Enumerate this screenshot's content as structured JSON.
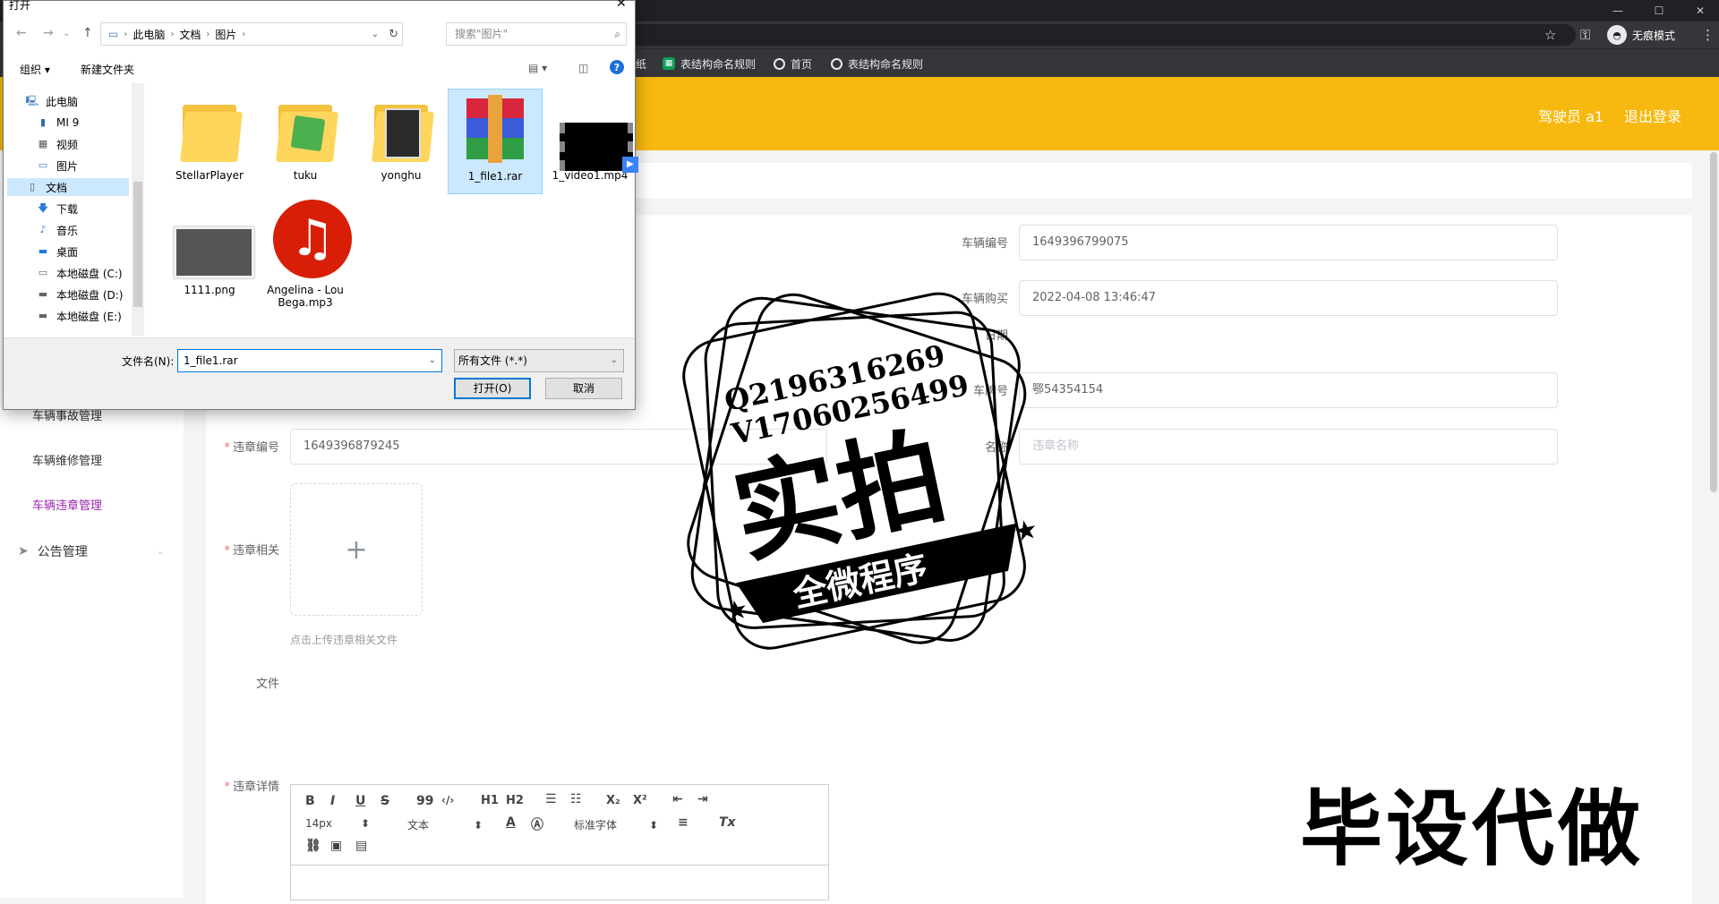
{
  "browser": {
    "incognito_label": "无痕模式",
    "bookmarks": [
      {
        "label": "纸",
        "icon": "none"
      },
      {
        "label": "表结构命名规则",
        "icon": "sheet-icon"
      },
      {
        "label": "首页",
        "icon": "globe-icon"
      },
      {
        "label": "表结构命名规则",
        "icon": "globe-icon"
      }
    ]
  },
  "header": {
    "user_label": "驾驶员 a1",
    "logout_label": "退出登录",
    "bg_color": "#f7b90f"
  },
  "sidebar": {
    "items": [
      {
        "label": "车辆事故管理",
        "active": false
      },
      {
        "label": "车辆维修管理",
        "active": false
      },
      {
        "label": "车辆违章管理",
        "active": true
      }
    ],
    "group": {
      "label": "公告管理"
    }
  },
  "form": {
    "vehicle_no": {
      "label": "车辆编号",
      "value": "1649396799075"
    },
    "purchase_date": {
      "label": "车辆购买",
      "label2": "日期",
      "value": "2022-04-08 13:46:47"
    },
    "plate_no": {
      "label": "车牌号",
      "value": "鄂54354154"
    },
    "violation_no": {
      "label": "违章编号",
      "value": "1649396879245"
    },
    "violation_name": {
      "label": "名称",
      "placeholder": "违章名称"
    },
    "related": {
      "label": "违章相关",
      "plus": "+",
      "hint": "点击上传违章相关文件"
    },
    "file_label": "文件",
    "details": {
      "label": "违章详情"
    }
  },
  "editor": {
    "bold": "B",
    "italic": "I",
    "underline": "U",
    "strike": "S",
    "quote": "99",
    "code": "‹/›",
    "h1": "H1",
    "h2": "H2",
    "sub": "X₂",
    "sup": "X²",
    "font_size": "14px",
    "text_style": "文本",
    "font_family": "标准字体"
  },
  "dialog": {
    "title": "打开",
    "breadcrumb": [
      "此电脑",
      "文档",
      "图片"
    ],
    "search_placeholder": "搜索\"图片\"",
    "organize_label": "组织 ▾",
    "new_folder_label": "新建文件夹",
    "tree": [
      {
        "label": "此电脑",
        "icon": "computer-icon",
        "selected": false
      },
      {
        "label": "MI 9",
        "icon": "phone-icon",
        "selected": false
      },
      {
        "label": "视频",
        "icon": "video-folder-icon",
        "selected": false
      },
      {
        "label": "图片",
        "icon": "picture-folder-icon",
        "selected": false
      },
      {
        "label": "文档",
        "icon": "document-folder-icon",
        "selected": true
      },
      {
        "label": "下载",
        "icon": "download-icon",
        "selected": false
      },
      {
        "label": "音乐",
        "icon": "music-icon",
        "selected": false
      },
      {
        "label": "桌面",
        "icon": "desktop-icon",
        "selected": false
      },
      {
        "label": "本地磁盘 (C:)",
        "icon": "drive-icon",
        "selected": false
      },
      {
        "label": "本地磁盘 (D:)",
        "icon": "drive-icon",
        "selected": false
      },
      {
        "label": "本地磁盘 (E:)",
        "icon": "drive-icon",
        "selected": false
      }
    ],
    "files": [
      {
        "name": "StellarPlayer",
        "kind": "folder"
      },
      {
        "name": "tuku",
        "kind": "folder"
      },
      {
        "name": "yonghu",
        "kind": "folder"
      },
      {
        "name": "1_file1.rar",
        "kind": "rar",
        "selected": true
      },
      {
        "name": "1_video1.mp4",
        "kind": "video"
      },
      {
        "name": "1111.png",
        "kind": "image"
      },
      {
        "name": "Angelina - Lou Bega.mp3",
        "kind": "audio"
      }
    ],
    "filename_label": "文件名(N):",
    "filename_value": "1_file1.rar",
    "filetype_value": "所有文件 (*.*)",
    "open_label": "打开(O)",
    "cancel_label": "取消"
  },
  "stamp": {
    "line1": "Q2196316269",
    "line2": "V17060256499",
    "big": "实拍",
    "ribbon": "全微程序"
  },
  "corner_text": "毕设代做"
}
